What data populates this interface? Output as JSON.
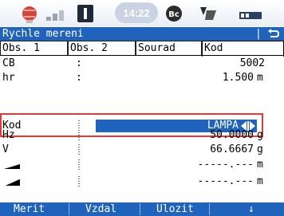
{
  "status": {
    "time": "14:22",
    "icons": [
      "satellite-icon",
      "signal-icon",
      "battery-icon",
      "bluetooth-icon",
      "tracking-icon",
      "memory-icon"
    ]
  },
  "title": {
    "text": "Rychle mereni",
    "separator": "|"
  },
  "tabs": [
    {
      "label": "Obs. 1"
    },
    {
      "label": "Obs. 2"
    },
    {
      "label": "Sourad"
    },
    {
      "label": "Kod"
    }
  ],
  "rows": [
    {
      "label": "CB",
      "value": "5002",
      "unit": ""
    },
    {
      "label": "hr",
      "value": "1.500",
      "unit": "m"
    },
    {
      "label": "Kod",
      "value": "LAMPA",
      "unit": ""
    },
    {
      "label": "Hz",
      "value": "50.0000",
      "unit": "g"
    },
    {
      "label": "V",
      "value": "66.6667",
      "unit": "g"
    },
    {
      "label": "",
      "value": "-----.---",
      "unit": "m"
    },
    {
      "label": "",
      "value": "-----.---",
      "unit": "m"
    }
  ],
  "softkeys": {
    "k1": "Merit",
    "k2": "Vzdal",
    "k3": "Ulozit",
    "k4": "↓"
  },
  "colors": {
    "accent": "#1f63bd",
    "highlight_border": "#e23a3a"
  }
}
